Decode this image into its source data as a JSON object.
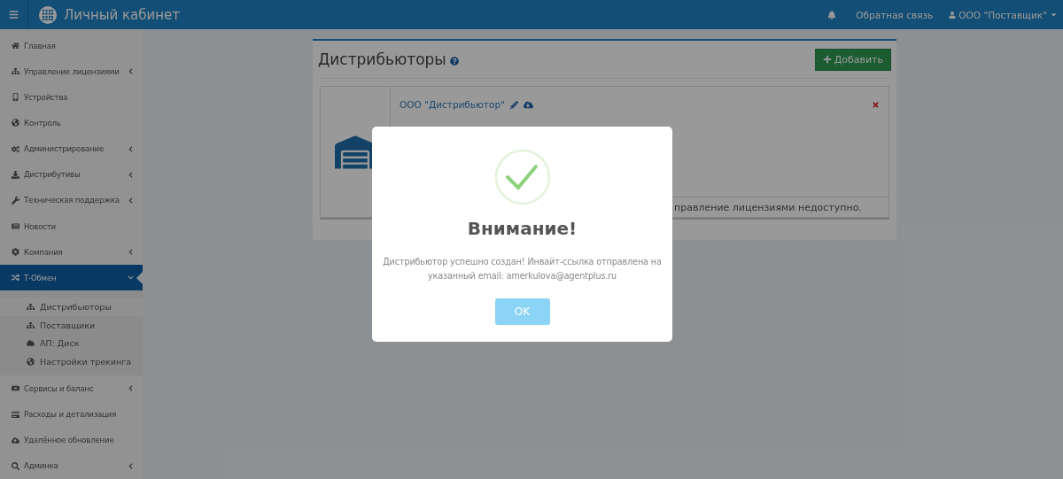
{
  "topbar": {
    "title": "Личный кабинет",
    "feedback": "Обратная связь",
    "user": "ООО \"Поставщик\""
  },
  "sidebar": {
    "items": [
      {
        "label": "Главная",
        "kind": "link",
        "selected": false
      },
      {
        "label": "Управление лицензиями",
        "kind": "group",
        "expanded": false,
        "selected": false
      },
      {
        "label": "Устройства",
        "kind": "link",
        "selected": false
      },
      {
        "label": "Контроль",
        "kind": "link",
        "selected": false
      },
      {
        "label": "Администрирование",
        "kind": "group",
        "expanded": false,
        "selected": false
      },
      {
        "label": "Дистрибутивы",
        "kind": "group",
        "expanded": false,
        "selected": false
      },
      {
        "label": "Техническая поддержка",
        "kind": "group",
        "expanded": false,
        "selected": false
      },
      {
        "label": "Новости",
        "kind": "link",
        "selected": false
      },
      {
        "label": "Компания",
        "kind": "group",
        "expanded": false,
        "selected": false
      },
      {
        "label": "Т-Обмен",
        "kind": "group",
        "expanded": true,
        "selected": true,
        "children": [
          {
            "label": "Дистрибьюторы",
            "selected": true
          },
          {
            "label": "Поставщики",
            "selected": false
          },
          {
            "label": "АП: Диск",
            "selected": false
          },
          {
            "label": "Настройки трекинга",
            "selected": false
          }
        ]
      },
      {
        "label": "Сервисы и баланс",
        "kind": "group",
        "expanded": false,
        "selected": false
      },
      {
        "label": "Расходы и детализация",
        "kind": "link",
        "selected": false
      },
      {
        "label": "Удалённое обновление",
        "kind": "link",
        "selected": false
      },
      {
        "label": "Админка",
        "kind": "group",
        "expanded": false,
        "selected": false
      }
    ]
  },
  "panel": {
    "title": "Дистрибьюторы",
    "add_button": "Добавить",
    "card": {
      "name": "ООО \"Дистрибьютор\"",
      "footer": "правление лицензиями недоступно."
    }
  },
  "dialog": {
    "title": "Внимание!",
    "message": "Дистрибьютор успешно создан! Инвайт-ссылка отправлена на указанный email: amerkulova@agentplus.ru",
    "button": "OK"
  }
}
